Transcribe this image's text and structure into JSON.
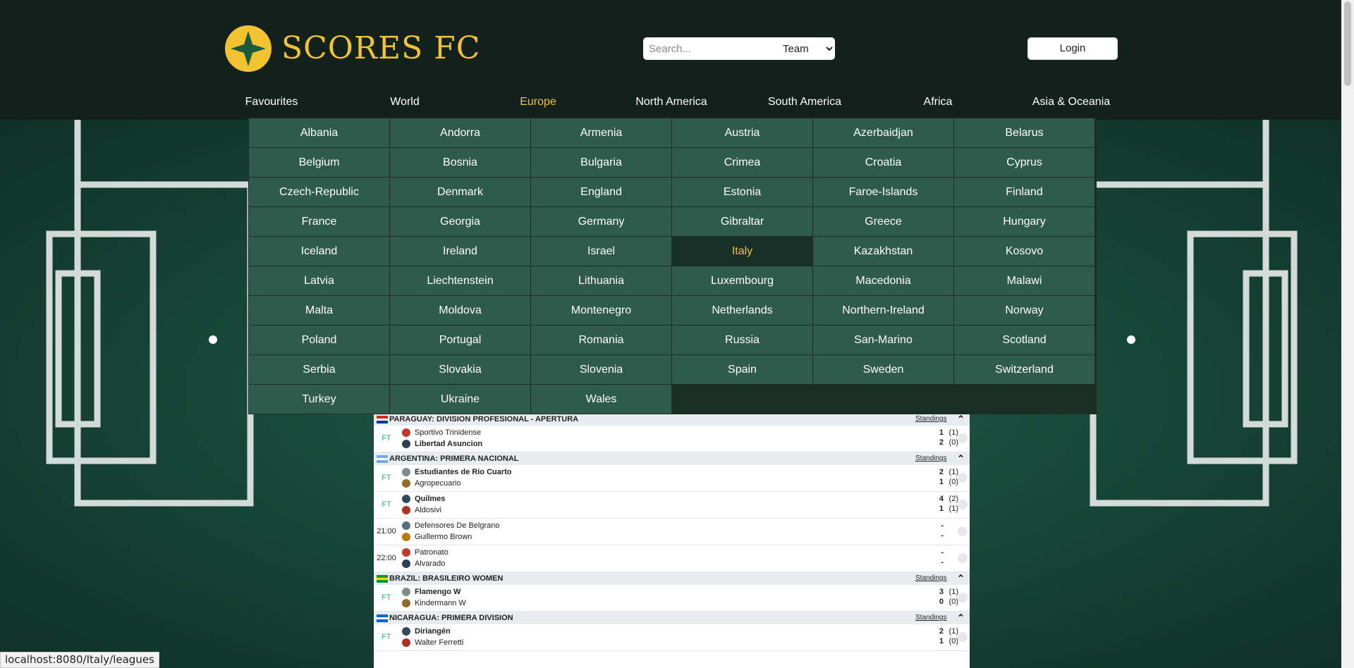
{
  "brand": {
    "name": "SCORES FC",
    "accent": "#f2c230"
  },
  "search": {
    "placeholder": "Search...",
    "type_selected": "Team",
    "type_options": [
      "Team"
    ]
  },
  "login": {
    "label": "Login"
  },
  "nav": {
    "items": [
      "Favourites",
      "World",
      "Europe",
      "North America",
      "South America",
      "Africa",
      "Asia & Oceania"
    ],
    "active": "Europe"
  },
  "countries": {
    "items": [
      "Albania",
      "Andorra",
      "Armenia",
      "Austria",
      "Azerbaidjan",
      "Belarus",
      "Belgium",
      "Bosnia",
      "Bulgaria",
      "Crimea",
      "Croatia",
      "Cyprus",
      "Czech-Republic",
      "Denmark",
      "England",
      "Estonia",
      "Faroe-Islands",
      "Finland",
      "France",
      "Georgia",
      "Germany",
      "Gibraltar",
      "Greece",
      "Hungary",
      "Iceland",
      "Ireland",
      "Israel",
      "Italy",
      "Kazakhstan",
      "Kosovo",
      "Latvia",
      "Liechtenstein",
      "Lithuania",
      "Luxembourg",
      "Macedonia",
      "Malawi",
      "Malta",
      "Moldova",
      "Montenegro",
      "Netherlands",
      "Northern-Ireland",
      "Norway",
      "Poland",
      "Portugal",
      "Romania",
      "Russia",
      "San-Marino",
      "Scotland",
      "Serbia",
      "Slovakia",
      "Slovenia",
      "Spain",
      "Sweden",
      "Switzerland",
      "Turkey",
      "Ukraine",
      "Wales"
    ],
    "active": "Italy"
  },
  "scores": {
    "top_row": {
      "score_home": "-",
      "score_away": "-"
    },
    "standings_label": "Standings",
    "leagues": [
      {
        "name": "PARAGUAY: DIVISION PROFESIONAL - APERTURA",
        "flag": "paraguay-flag",
        "matches": [
          {
            "status": "FT",
            "home": "Sportivo Trinidense",
            "away": "Libertad Asuncion",
            "home_bold": false,
            "away_bold": true,
            "score_home": "1",
            "score_away": "2",
            "ht_home": "(1)",
            "ht_away": "(0)"
          }
        ]
      },
      {
        "name": "ARGENTINA: PRIMERA NACIONAL",
        "flag": "argentina-flag",
        "matches": [
          {
            "status": "FT",
            "home": "Estudiantes de Rio Cuarto",
            "away": "Agropecuario",
            "home_bold": true,
            "away_bold": false,
            "score_home": "2",
            "score_away": "1",
            "ht_home": "(1)",
            "ht_away": "(0)"
          },
          {
            "status": "FT",
            "home": "Quilmes",
            "away": "Aldosivi",
            "home_bold": true,
            "away_bold": false,
            "score_home": "4",
            "score_away": "1",
            "ht_home": "(2)",
            "ht_away": "(1)"
          },
          {
            "status": "21:00",
            "home": "Defensores De Belgrano",
            "away": "Guillermo Brown",
            "home_bold": false,
            "away_bold": false,
            "score_home": "-",
            "score_away": "-",
            "ht_home": "",
            "ht_away": ""
          },
          {
            "status": "22:00",
            "home": "Patronato",
            "away": "Alvarado",
            "home_bold": false,
            "away_bold": false,
            "score_home": "-",
            "score_away": "-",
            "ht_home": "",
            "ht_away": ""
          }
        ]
      },
      {
        "name": "BRAZIL: BRASILEIRO WOMEN",
        "flag": "brazil-flag",
        "matches": [
          {
            "status": "FT",
            "home": "Flamengo W",
            "away": "Kindermann W",
            "home_bold": true,
            "away_bold": false,
            "score_home": "3",
            "score_away": "0",
            "ht_home": "(1)",
            "ht_away": "(0)"
          }
        ]
      },
      {
        "name": "NICARAGUA: PRIMERA DIVISION",
        "flag": "nicaragua-flag",
        "matches": [
          {
            "status": "FT",
            "home": "Diriangén",
            "away": "Walter Ferretti",
            "home_bold": true,
            "away_bold": false,
            "score_home": "2",
            "score_away": "1",
            "ht_home": "(1)",
            "ht_away": "(0)"
          }
        ]
      }
    ]
  },
  "statusbar": {
    "url": "localhost:8080/Italy/leagues"
  }
}
